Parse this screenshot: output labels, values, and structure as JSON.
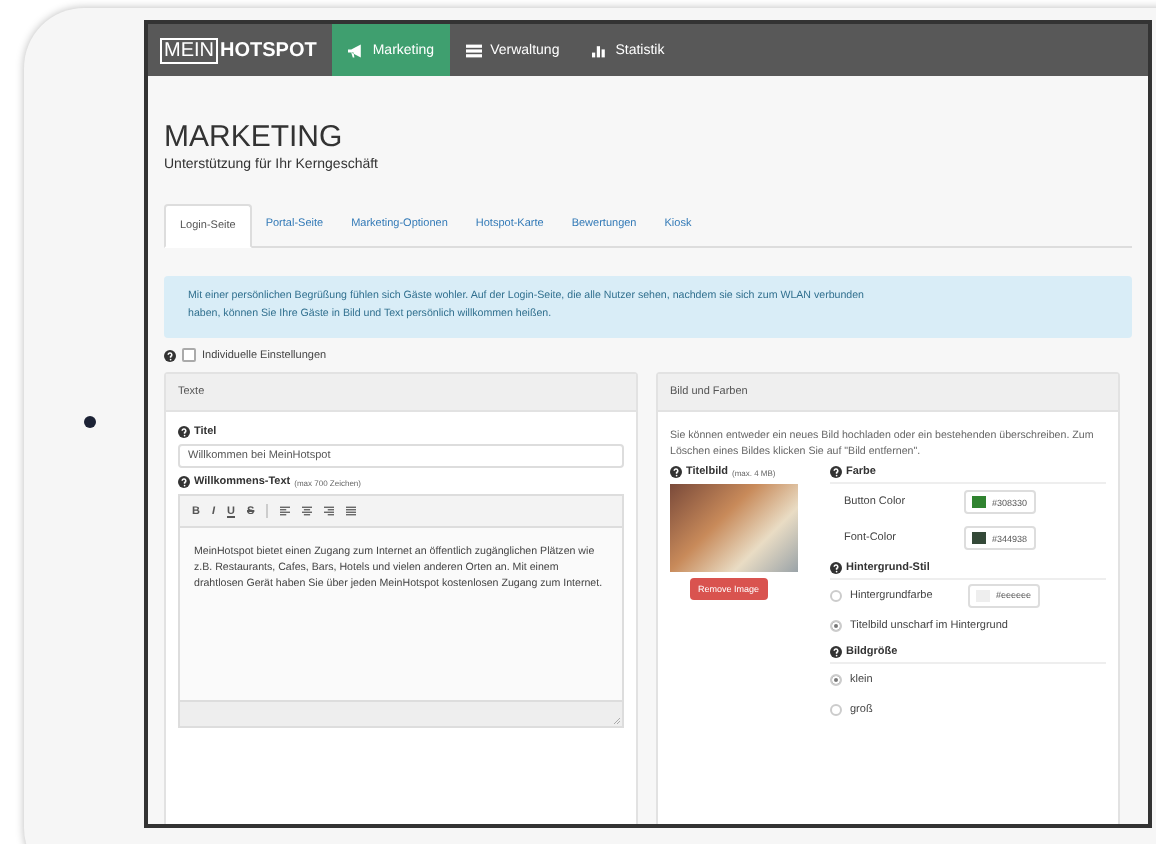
{
  "brand": {
    "boxed": "MEIN",
    "text": "HOTSPOT"
  },
  "nav": [
    {
      "label": "Marketing",
      "kind": "megaphone",
      "selected": true
    },
    {
      "label": "Verwaltung",
      "kind": "list",
      "selected": false
    },
    {
      "label": "Statistik",
      "kind": "chart",
      "selected": false
    }
  ],
  "page": {
    "title": "MARKETING",
    "subtitle": "Unterstützung für Ihr Kerngeschäft"
  },
  "tabs": [
    {
      "label": "Login-Seite",
      "selected": true
    },
    {
      "label": "Portal-Seite",
      "selected": false
    },
    {
      "label": "Marketing-Optionen",
      "selected": false
    },
    {
      "label": "Hotspot-Karte",
      "selected": false
    },
    {
      "label": "Bewertungen",
      "selected": false
    },
    {
      "label": "Kiosk",
      "selected": false
    }
  ],
  "info": "Mit einer persönlichen Begrüßung fühlen sich Gäste wohler. Auf der Login-Seite, die alle Nutzer sehen, nachdem sie sich zum WLAN verbunden haben, können Sie Ihre Gäste in Bild und Text persönlich willkommen heißen.",
  "individual_settings": {
    "label": "Individuelle Einstellungen",
    "checked": false
  },
  "texts_panel": {
    "title": "Texte",
    "title_label": "Titel",
    "title_value": "Willkommen bei MeinHotspot",
    "welcome_label": "Willkommens-Text",
    "welcome_hint": "(max 700 Zeichen)",
    "format_buttons": [
      "B",
      "I",
      "U",
      "S"
    ],
    "welcome_text": "MeinHotspot bietet einen Zugang zum Internet an öffentlich zugänglichen Plätzen wie z.B. Restaurants, Cafes, Bars, Hotels und vielen anderen Orten an. Mit einem drahtlosen Gerät haben Sie über jeden MeinHotspot kostenlosen Zugang zum Internet."
  },
  "image_panel": {
    "title": "Bild und Farben",
    "description": "Sie können entweder ein neues Bild hochladen oder ein bestehenden überschreiben. Zum Löschen eines Bildes klicken Sie auf \"Bild entfernen\".",
    "image_label": "Titelbild",
    "image_hint": "(max. 4 MB)",
    "remove_button": "Remove Image",
    "color_heading": "Farbe",
    "colors": [
      {
        "label": "Button Color",
        "value": "#308330",
        "color": "#308330"
      },
      {
        "label": "Font-Color",
        "value": "#344938",
        "color": "#344938"
      }
    ],
    "bg_heading": "Hintergrund-Stil",
    "bg_options": [
      {
        "label": "Hintergrundfarbe",
        "selected": false,
        "value": "#eeeeee"
      },
      {
        "label": "Titelbild unscharf im Hintergrund",
        "selected": true
      }
    ],
    "size_heading": "Bildgröße",
    "sizes": [
      {
        "label": "klein",
        "selected": true
      },
      {
        "label": "groß",
        "selected": false
      }
    ]
  }
}
